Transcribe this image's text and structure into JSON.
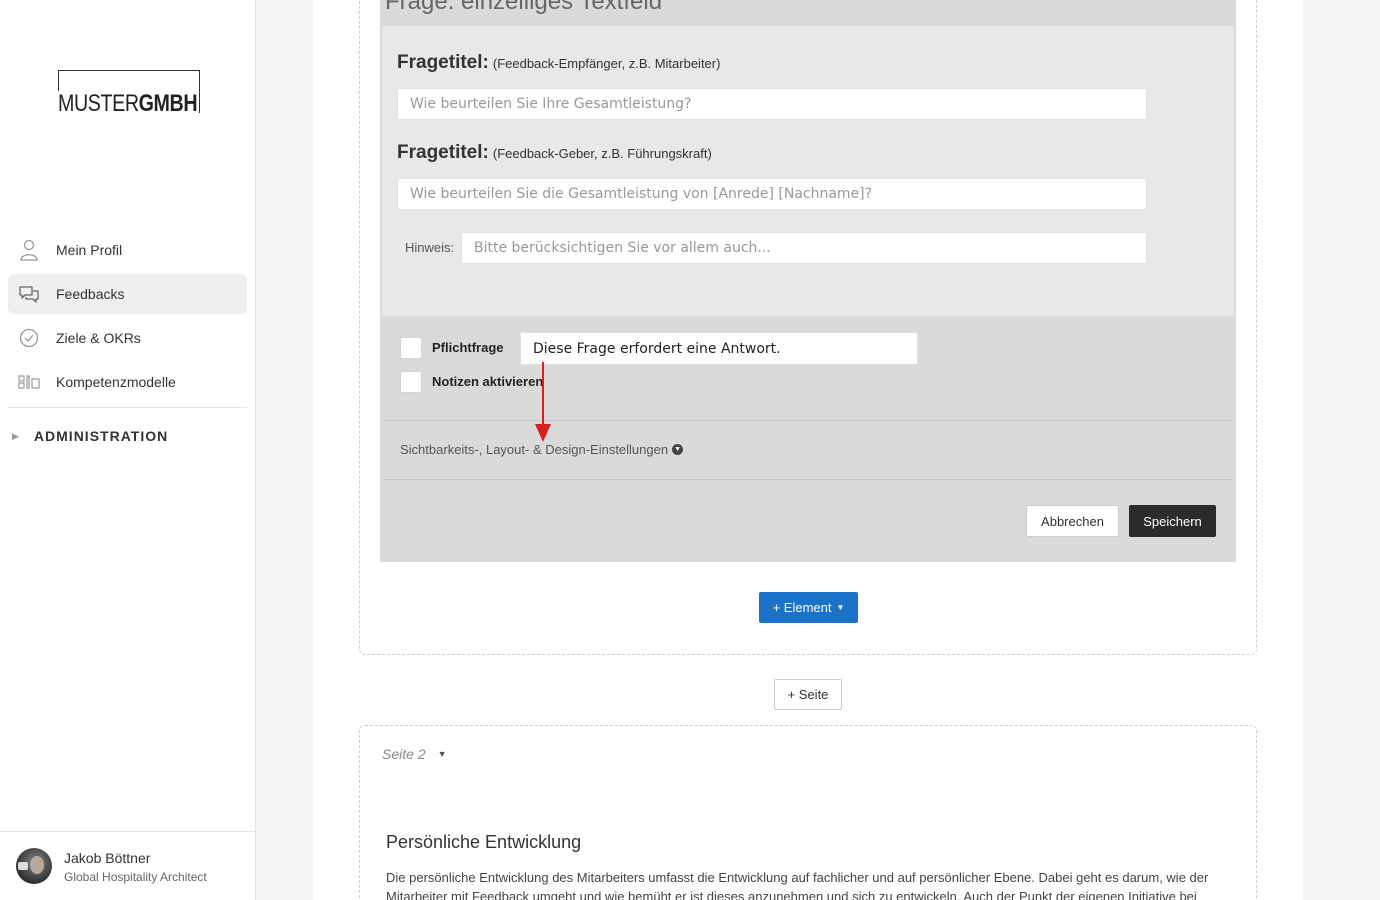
{
  "sidebar": {
    "logo": {
      "part1": "MUSTER",
      "part2": "GMBH"
    },
    "nav": [
      {
        "label": "Mein Profil",
        "icon": "user-icon"
      },
      {
        "label": "Feedbacks",
        "icon": "chat-icon",
        "active": true
      },
      {
        "label": "Ziele & OKRs",
        "icon": "check-circle-icon"
      },
      {
        "label": "Kompetenzmodelle",
        "icon": "grid-icon"
      }
    ],
    "admin_label": "ADMINISTRATION",
    "user": {
      "name": "Jakob Böttner",
      "role": "Global Hospitality Architect"
    }
  },
  "editor": {
    "title": "Frage: einzeiliges Textfeld",
    "q1": {
      "label": "Fragetitel:",
      "sub": "(Feedback-Empfänger, z.B. Mitarbeiter)",
      "placeholder": "Wie beurteilen Sie Ihre Gesamtleistung?"
    },
    "q2": {
      "label": "Fragetitel:",
      "sub": "(Feedback-Geber, z.B. Führungskraft)",
      "placeholder": "Wie beurteilen Sie die Gesamtleistung von [Anrede] [Nachname]?"
    },
    "hint": {
      "label": "Hinweis:",
      "placeholder": "Bitte berücksichtigen Sie vor allem auch..."
    },
    "required": {
      "label": "Pflichtfrage",
      "value": "Diese Frage erfordert eine Antwort."
    },
    "notes": {
      "label": "Notizen aktivieren"
    },
    "visibility_label": "Sichtbarkeits-, Layout- & Design-Einstellungen",
    "cancel_label": "Abbrechen",
    "save_label": "Speichern"
  },
  "add_element_label": "+ Element",
  "add_page_label": "+ Seite",
  "page2": {
    "label": "Seite 2",
    "section_title": "Persönliche Entwicklung",
    "section_text": "Die persönliche Entwicklung des Mitarbeiters umfasst die Entwicklung auf fachlicher und auf persönlicher Ebene. Dabei geht es darum, wie der Mitarbeiter mit Feedback umgeht und wie bemüht er ist dieses anzunehmen und sich zu entwickeln. Auch der Punkt der eigenen Initiative bei"
  },
  "colors": {
    "primary": "#1a73c8",
    "save": "#2b2b2b",
    "annotation_arrow": "#d62020"
  }
}
